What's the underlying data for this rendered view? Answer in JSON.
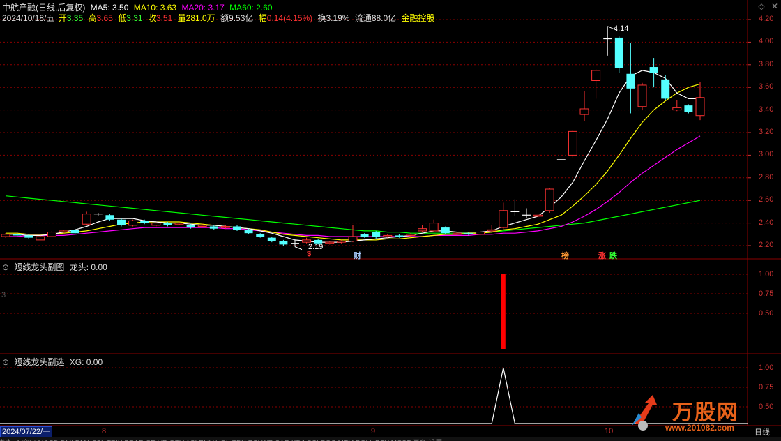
{
  "header": {
    "stock_title": "中航产融(日线,后复权)",
    "ma5": "MA5: 3.50",
    "ma10": "MA10: 3.63",
    "ma20": "MA20: 3.17",
    "ma60": "MA60: 2.60",
    "date": "2024/10/18/五",
    "open_label": "开",
    "open": "3.35",
    "high_label": "高",
    "high": "3.65",
    "low_label": "低",
    "low": "3.31",
    "close_label": "收",
    "close": "3.51",
    "volume_label": "量",
    "volume": "281.0万",
    "amount": "额9.53亿",
    "change_label": "幅",
    "change": "0.14(4.15%)",
    "turnover": "换3.19%",
    "float": "流通88.0亿",
    "tag": "金融控股"
  },
  "colors": {
    "ma5": "#ffffff",
    "ma10": "#ffff00",
    "ma20": "#ff00ff",
    "ma60": "#00ff00",
    "up": "#ff3232",
    "down": "#54ffff",
    "grid": "#8b0000",
    "axis": "#c33"
  },
  "price_axis": [
    "4.20",
    "4.00",
    "3.80",
    "3.60",
    "3.40",
    "3.20",
    "3.00",
    "2.80",
    "2.60",
    "2.40",
    "2.20"
  ],
  "annotations": {
    "high_price": "4.14",
    "low_price": "2.19"
  },
  "markers": [
    {
      "text": "$",
      "color": "#ff3232"
    },
    {
      "text": "财",
      "color": "#aaccff"
    },
    {
      "text": "榜",
      "color": "#ff9933"
    },
    {
      "text": "涨",
      "color": "#ff3232"
    },
    {
      "text": "跌",
      "color": "#33ff33"
    }
  ],
  "sub1": {
    "title": "短线龙头副图",
    "value": "龙头: 0.00",
    "axis": [
      "1.00",
      "0.75",
      "0.50"
    ],
    "left_num": "3"
  },
  "sub2": {
    "title": "短线龙头副选",
    "value": "XG: 0.00",
    "axis": [
      "1.00",
      "0.75",
      "0.50"
    ]
  },
  "xaxis": {
    "date_box": "2024/07/22/一",
    "months": [
      "8",
      "9",
      "10"
    ]
  },
  "corner": "日线",
  "bottom_tabs": "指标 A 窗口 MACD DMI DMA FSL TRIX BRAR CR VR OBV ASI EMV VOL-TDX RSI WR SAR KDJ CCI ROC MTM BOLL PSY MCST 更多 设置",
  "logo": {
    "name": "万股网",
    "url": "www.201082.com"
  },
  "chart_data": {
    "type": "candlestick",
    "title": "中航产融(日线,后复权)",
    "ylim": [
      2.15,
      4.25
    ],
    "candles": [
      {
        "o": 2.28,
        "c": 2.3,
        "h": 2.31,
        "l": 2.27
      },
      {
        "o": 2.3,
        "c": 2.29,
        "h": 2.32,
        "l": 2.28
      },
      {
        "o": 2.29,
        "c": 2.27,
        "h": 2.3,
        "l": 2.26
      },
      {
        "o": 2.25,
        "c": 2.28,
        "h": 2.29,
        "l": 2.25
      },
      {
        "o": 2.28,
        "c": 2.32,
        "h": 2.33,
        "l": 2.28
      },
      {
        "o": 2.32,
        "c": 2.33,
        "h": 2.34,
        "l": 2.31
      },
      {
        "o": 2.34,
        "c": 2.31,
        "h": 2.35,
        "l": 2.3
      },
      {
        "o": 2.39,
        "c": 2.48,
        "h": 2.5,
        "l": 2.38
      },
      {
        "o": 2.48,
        "c": 2.48,
        "h": 2.49,
        "l": 2.46
      },
      {
        "o": 2.47,
        "c": 2.43,
        "h": 2.48,
        "l": 2.42
      },
      {
        "o": 2.43,
        "c": 2.38,
        "h": 2.44,
        "l": 2.37
      },
      {
        "o": 2.38,
        "c": 2.42,
        "h": 2.43,
        "l": 2.37
      },
      {
        "o": 2.42,
        "c": 2.4,
        "h": 2.43,
        "l": 2.39
      },
      {
        "o": 2.38,
        "c": 2.4,
        "h": 2.41,
        "l": 2.37
      },
      {
        "o": 2.4,
        "c": 2.38,
        "h": 2.41,
        "l": 2.37
      },
      {
        "o": 2.39,
        "c": 2.4,
        "h": 2.41,
        "l": 2.38
      },
      {
        "o": 2.38,
        "c": 2.36,
        "h": 2.39,
        "l": 2.35
      },
      {
        "o": 2.37,
        "c": 2.38,
        "h": 2.39,
        "l": 2.36
      },
      {
        "o": 2.37,
        "c": 2.35,
        "h": 2.38,
        "l": 2.34
      },
      {
        "o": 2.36,
        "c": 2.37,
        "h": 2.38,
        "l": 2.35
      },
      {
        "o": 2.37,
        "c": 2.34,
        "h": 2.38,
        "l": 2.33
      },
      {
        "o": 2.34,
        "c": 2.31,
        "h": 2.35,
        "l": 2.3
      },
      {
        "o": 2.3,
        "c": 2.28,
        "h": 2.31,
        "l": 2.27
      },
      {
        "o": 2.27,
        "c": 2.24,
        "h": 2.28,
        "l": 2.23
      },
      {
        "o": 2.24,
        "c": 2.21,
        "h": 2.25,
        "l": 2.2
      },
      {
        "o": 2.22,
        "c": 2.22,
        "h": 2.25,
        "l": 2.19
      },
      {
        "o": 2.23,
        "c": 2.25,
        "h": 2.27,
        "l": 2.22
      },
      {
        "o": 2.25,
        "c": 2.22,
        "h": 2.26,
        "l": 2.21
      },
      {
        "o": 2.22,
        "c": 2.23,
        "h": 2.24,
        "l": 2.21
      },
      {
        "o": 2.23,
        "c": 2.24,
        "h": 2.25,
        "l": 2.22
      },
      {
        "o": 2.24,
        "c": 2.28,
        "h": 2.38,
        "l": 2.23
      },
      {
        "o": 2.3,
        "c": 2.28,
        "h": 2.31,
        "l": 2.27
      },
      {
        "o": 2.32,
        "c": 2.28,
        "h": 2.33,
        "l": 2.26
      },
      {
        "o": 2.28,
        "c": 2.29,
        "h": 2.3,
        "l": 2.27
      },
      {
        "o": 2.29,
        "c": 2.28,
        "h": 2.3,
        "l": 2.27
      },
      {
        "o": 2.29,
        "c": 2.3,
        "h": 2.31,
        "l": 2.28
      },
      {
        "o": 2.33,
        "c": 2.35,
        "h": 2.38,
        "l": 2.32
      },
      {
        "o": 2.33,
        "c": 2.4,
        "h": 2.43,
        "l": 2.32
      },
      {
        "o": 2.36,
        "c": 2.31,
        "h": 2.37,
        "l": 2.3
      },
      {
        "o": 2.3,
        "c": 2.31,
        "h": 2.32,
        "l": 2.29
      },
      {
        "o": 2.31,
        "c": 2.3,
        "h": 2.32,
        "l": 2.29
      },
      {
        "o": 2.3,
        "c": 2.32,
        "h": 2.33,
        "l": 2.29
      },
      {
        "o": 2.33,
        "c": 2.34,
        "h": 2.38,
        "l": 2.32
      },
      {
        "o": 2.36,
        "c": 2.51,
        "h": 2.58,
        "l": 2.35
      },
      {
        "o": 2.5,
        "c": 2.5,
        "h": 2.61,
        "l": 2.46
      },
      {
        "o": 2.47,
        "c": 2.47,
        "h": 2.53,
        "l": 2.44
      },
      {
        "o": 2.46,
        "c": 2.47,
        "h": 2.48,
        "l": 2.45
      },
      {
        "o": 2.51,
        "c": 2.7,
        "h": 2.71,
        "l": 2.49
      },
      {
        "o": 2.96,
        "c": 2.96,
        "h": 2.96,
        "l": 2.96
      },
      {
        "o": 3.0,
        "c": 3.21,
        "h": 3.22,
        "l": 2.98
      },
      {
        "o": 3.36,
        "c": 3.41,
        "h": 3.57,
        "l": 3.3
      },
      {
        "o": 3.66,
        "c": 3.75,
        "h": 3.76,
        "l": 3.5
      },
      {
        "o": 4.03,
        "c": 4.03,
        "h": 4.14,
        "l": 3.88
      },
      {
        "o": 4.04,
        "c": 3.77,
        "h": 4.05,
        "l": 3.73
      },
      {
        "o": 3.72,
        "c": 3.59,
        "h": 3.99,
        "l": 3.37
      },
      {
        "o": 3.43,
        "c": 3.62,
        "h": 3.64,
        "l": 3.4
      },
      {
        "o": 3.78,
        "c": 3.73,
        "h": 3.86,
        "l": 3.6
      },
      {
        "o": 3.67,
        "c": 3.5,
        "h": 3.71,
        "l": 3.49
      },
      {
        "o": 3.4,
        "c": 3.42,
        "h": 3.49,
        "l": 3.39
      },
      {
        "o": 3.44,
        "c": 3.38,
        "h": 3.45,
        "l": 3.37
      },
      {
        "o": 3.35,
        "c": 3.51,
        "h": 3.65,
        "l": 3.31
      }
    ],
    "ma5": [
      2.3,
      2.3,
      2.29,
      2.29,
      2.3,
      2.32,
      2.34,
      2.37,
      2.41,
      2.44,
      2.44,
      2.44,
      2.42,
      2.41,
      2.4,
      2.4,
      2.39,
      2.38,
      2.38,
      2.37,
      2.36,
      2.35,
      2.33,
      2.31,
      2.28,
      2.25,
      2.24,
      2.23,
      2.23,
      2.23,
      2.24,
      2.25,
      2.26,
      2.27,
      2.28,
      2.29,
      2.31,
      2.33,
      2.33,
      2.32,
      2.32,
      2.32,
      2.33,
      2.37,
      2.4,
      2.43,
      2.46,
      2.54,
      2.63,
      2.76,
      2.95,
      3.13,
      3.32,
      3.55,
      3.7,
      3.75,
      3.73,
      3.68,
      3.55,
      3.5,
      3.5
    ],
    "ma10": [
      2.31,
      2.31,
      2.3,
      2.3,
      2.3,
      2.31,
      2.32,
      2.33,
      2.35,
      2.37,
      2.39,
      2.4,
      2.41,
      2.41,
      2.41,
      2.41,
      2.4,
      2.39,
      2.38,
      2.37,
      2.36,
      2.35,
      2.34,
      2.32,
      2.3,
      2.29,
      2.28,
      2.27,
      2.26,
      2.25,
      2.25,
      2.25,
      2.25,
      2.26,
      2.26,
      2.27,
      2.28,
      2.29,
      2.3,
      2.3,
      2.31,
      2.31,
      2.32,
      2.34,
      2.35,
      2.37,
      2.39,
      2.43,
      2.47,
      2.55,
      2.64,
      2.74,
      2.86,
      3.0,
      3.15,
      3.29,
      3.4,
      3.48,
      3.55,
      3.6,
      3.63
    ],
    "ma20": [
      2.28,
      2.28,
      2.29,
      2.29,
      2.29,
      2.29,
      2.3,
      2.31,
      2.32,
      2.33,
      2.34,
      2.35,
      2.36,
      2.36,
      2.36,
      2.36,
      2.36,
      2.36,
      2.36,
      2.35,
      2.35,
      2.34,
      2.33,
      2.32,
      2.31,
      2.3,
      2.29,
      2.29,
      2.28,
      2.28,
      2.28,
      2.28,
      2.28,
      2.28,
      2.28,
      2.28,
      2.28,
      2.29,
      2.29,
      2.29,
      2.29,
      2.3,
      2.3,
      2.31,
      2.31,
      2.32,
      2.33,
      2.35,
      2.37,
      2.41,
      2.46,
      2.52,
      2.59,
      2.67,
      2.76,
      2.84,
      2.91,
      2.98,
      3.05,
      3.11,
      3.17
    ],
    "ma60": [
      2.64,
      2.63,
      2.62,
      2.61,
      2.6,
      2.59,
      2.58,
      2.57,
      2.56,
      2.55,
      2.54,
      2.53,
      2.52,
      2.51,
      2.5,
      2.49,
      2.48,
      2.47,
      2.46,
      2.45,
      2.44,
      2.43,
      2.42,
      2.41,
      2.4,
      2.39,
      2.38,
      2.37,
      2.36,
      2.35,
      2.34,
      2.33,
      2.33,
      2.32,
      2.32,
      2.31,
      2.31,
      2.31,
      2.31,
      2.31,
      2.31,
      2.31,
      2.32,
      2.33,
      2.34,
      2.35,
      2.36,
      2.37,
      2.38,
      2.39,
      2.4,
      2.42,
      2.44,
      2.46,
      2.48,
      2.5,
      2.52,
      2.54,
      2.56,
      2.58,
      2.6
    ],
    "sub1_signal_index": 43,
    "sub1_signal_value": 1,
    "sub2_signal_index": 43,
    "sub2_signal_value": 1
  }
}
